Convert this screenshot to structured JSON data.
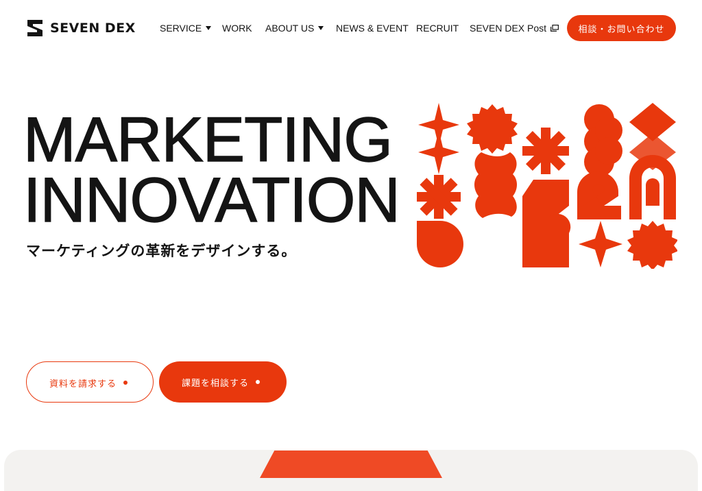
{
  "header": {
    "logo_text": "SEVEN DEX",
    "nav": [
      {
        "label": "SERVICE",
        "dropdown": true
      },
      {
        "label": "WORK",
        "dropdown": false
      },
      {
        "label": "ABOUT US",
        "dropdown": true
      },
      {
        "label": "NEWS & EVENT",
        "dropdown": false
      },
      {
        "label": "RECRUIT",
        "dropdown": false
      },
      {
        "label": "SEVEN DEX Post",
        "external": true
      }
    ],
    "cta_label": "相談・お問い合わせ"
  },
  "hero": {
    "title_line1": "MARKETING",
    "title_line2": "INNOVATION",
    "subtitle": "マーケティングの革新をデザインする。"
  },
  "buttons": {
    "request_docs": "資料を請求する",
    "consult": "課題を相談する"
  },
  "colors": {
    "accent": "#e8380d",
    "text": "#141414",
    "background": "#ffffff",
    "panel": "#f3f2f0"
  },
  "icons": [
    "logo-s-icon",
    "caret-down-icon",
    "external-window-icon",
    "dot-icon"
  ]
}
